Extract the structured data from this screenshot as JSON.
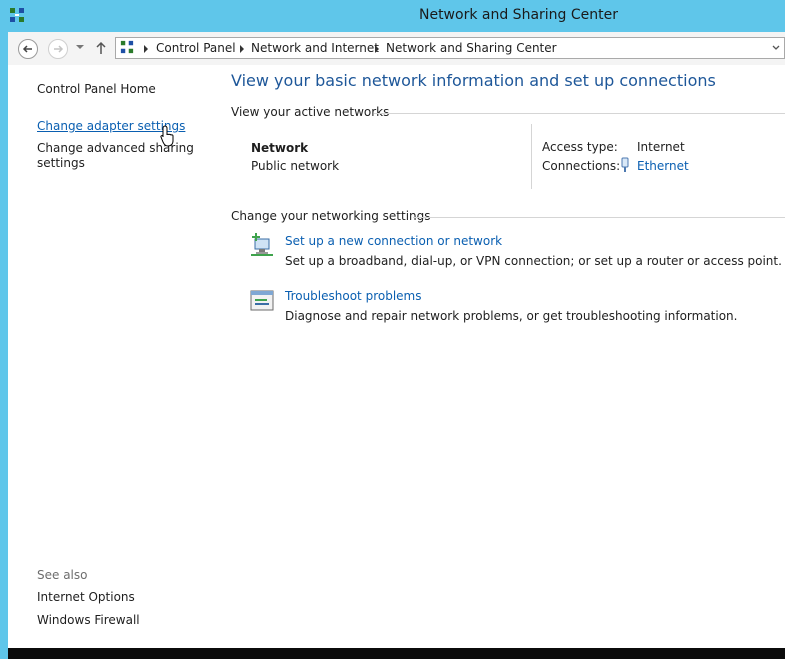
{
  "window": {
    "title": "Network and Sharing Center"
  },
  "address": {
    "crumbs": [
      "Control Panel",
      "Network and Internet",
      "Network and Sharing Center"
    ]
  },
  "sidebar": {
    "home": "Control Panel Home",
    "adapter": "Change adapter settings",
    "advanced_line1": "Change advanced sharing",
    "advanced_line2": "settings",
    "see_also": "See also",
    "internet_options": "Internet Options",
    "firewall": "Windows Firewall"
  },
  "main": {
    "title": "View your basic network information and set up connections",
    "active_networks_heading": "View your active networks",
    "network_name": "Network",
    "network_type": "Public network",
    "access_type_label": "Access type:",
    "access_type_value": "Internet",
    "connections_label": "Connections:",
    "connections_value": "Ethernet",
    "settings_heading": "Change your networking settings",
    "tasks": [
      {
        "title": "Set up a new connection or network",
        "desc": "Set up a broadband, dial-up, or VPN connection; or set up a router or access point."
      },
      {
        "title": "Troubleshoot problems",
        "desc": "Diagnose and repair network problems, or get troubleshooting information."
      }
    ]
  },
  "colors": {
    "titlebar": "#5fc6ea",
    "link": "#0a5fb1",
    "heading": "#1e5799"
  }
}
